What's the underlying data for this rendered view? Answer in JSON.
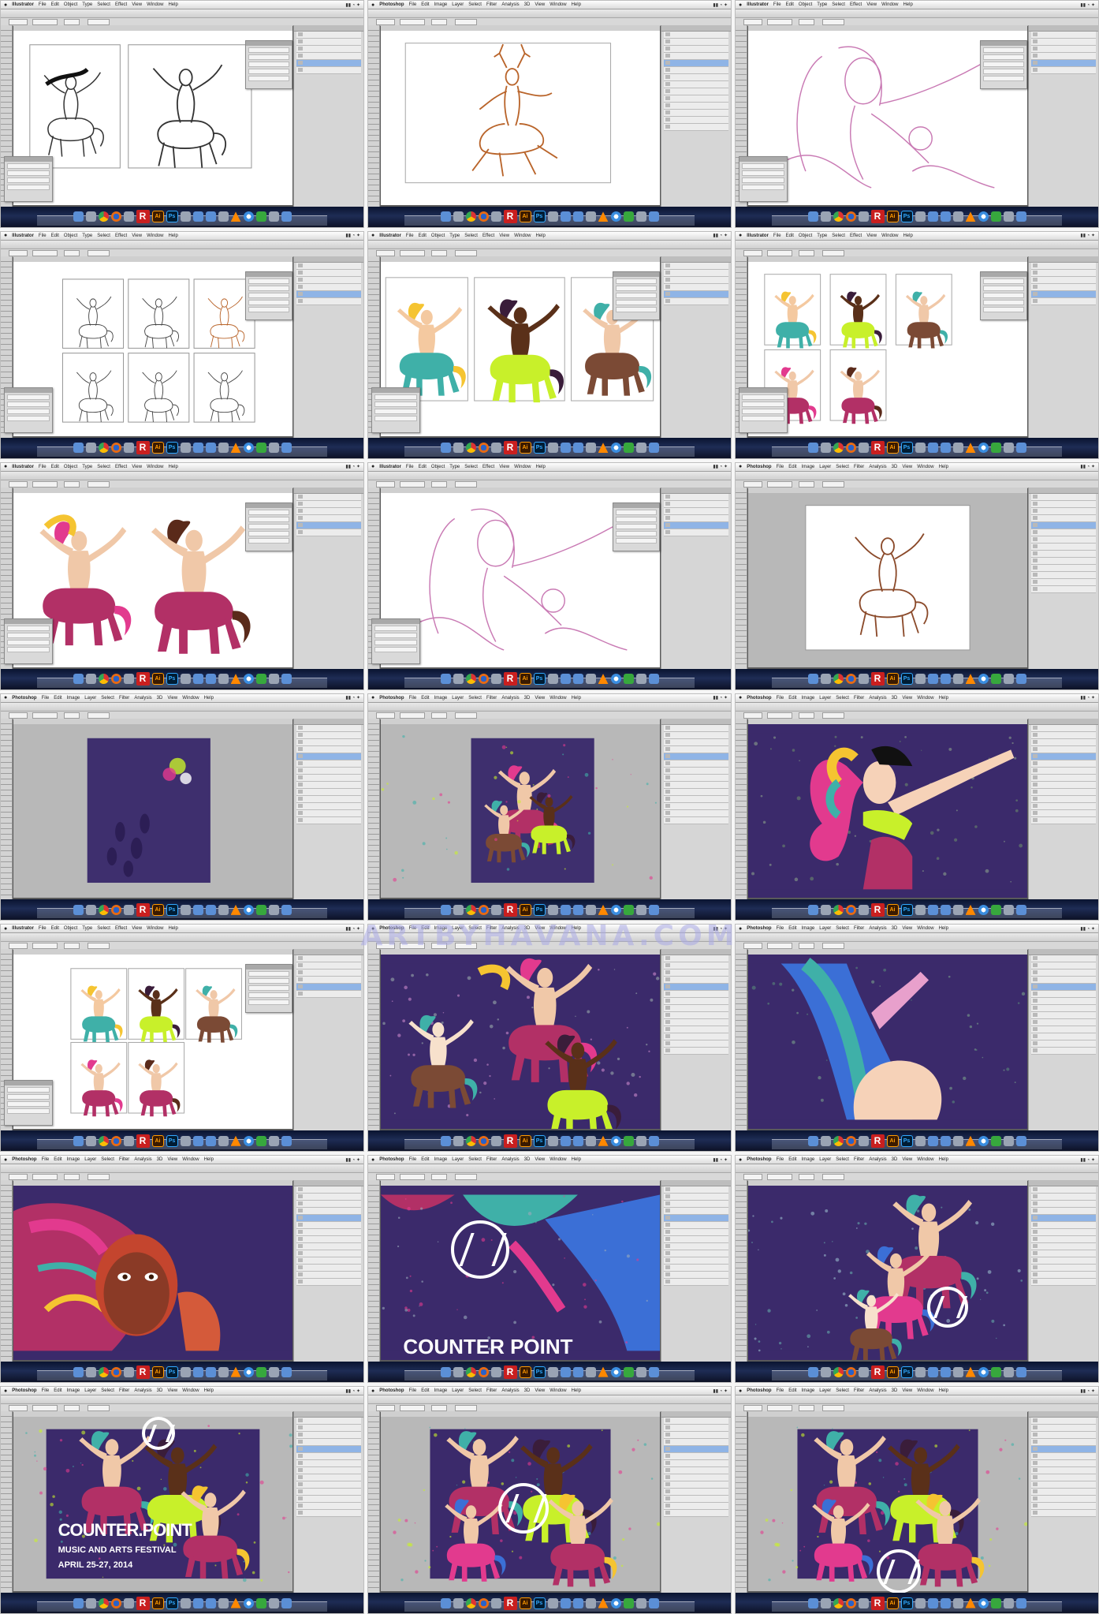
{
  "watermark": "ARTBYHAVANA.COM",
  "apps": {
    "illustrator": "Illustrator",
    "photoshop": "Photoshop"
  },
  "menu": [
    "File",
    "Edit",
    "Object",
    "Type",
    "Select",
    "Effect",
    "View",
    "Window",
    "Help"
  ],
  "ps_menu": [
    "File",
    "Edit",
    "Image",
    "Layer",
    "Select",
    "Filter",
    "Analysis",
    "3D",
    "View",
    "Window",
    "Help"
  ],
  "dock_labels": [
    "R",
    "Ai",
    "Ps"
  ],
  "poster": {
    "brand": "COUNTER POINT",
    "brand_dot": "COUNTER.POINT",
    "subtitle": "MUSIC AND ARTS FESTIVAL",
    "dates": "APRIL 25-27, 2014"
  },
  "colors": {
    "poster_purple": "#3b2a6b",
    "magenta": "#b23066",
    "lime": "#c8f02a",
    "teal": "#3fb0a8",
    "brown": "#7b4a35"
  }
}
